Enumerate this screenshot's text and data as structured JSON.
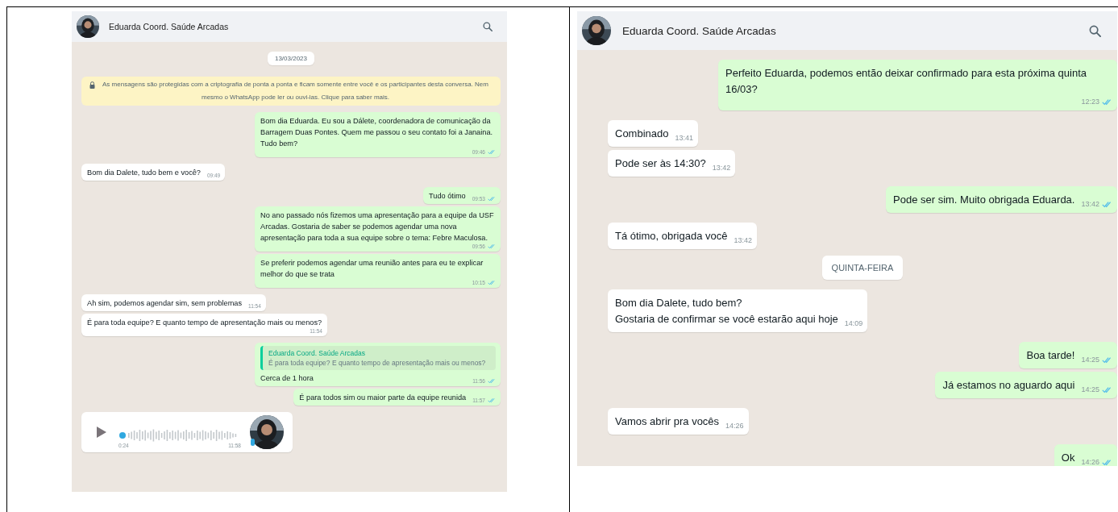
{
  "panels": [
    {
      "contact": "Eduarda Coord. Saúde Arcadas",
      "messages": [
        {
          "kind": "date",
          "text": "13/03/2023"
        },
        {
          "kind": "notice",
          "text": "As mensagens são protegidas com a criptografia de ponta a ponta e ficam somente entre você e os participantes desta conversa. Nem mesmo o WhatsApp pode ler ou ouvi-las. Clique para saber mais."
        },
        {
          "kind": "text",
          "sent": true,
          "text": "Bom dia Eduarda. Eu sou a Dálete, coordenadora de comunicação da Barragem Duas Pontes. Quem me passou o seu contato foi a Janaina. Tudo bem?",
          "time": "09:46",
          "read": true
        },
        {
          "kind": "text",
          "sent": false,
          "text": "Bom dia Dalete, tudo bem e você?",
          "time": "09:49"
        },
        {
          "kind": "text",
          "sent": true,
          "text": "Tudo ótimo",
          "time": "09:53",
          "read": true
        },
        {
          "kind": "text",
          "sent": true,
          "text": "No ano passado nós fizemos uma apresentação para a equipe da USF Arcadas. Gostaria de saber se podemos agendar uma nova apresentação para toda a sua equipe sobre o tema: Febre Maculosa.",
          "time": "09:56",
          "read": true
        },
        {
          "kind": "text",
          "sent": true,
          "text": "Se preferir podemos agendar uma reunião antes para eu te explicar melhor do que se trata",
          "time": "10:15",
          "read": true
        },
        {
          "kind": "text",
          "sent": false,
          "text": "Ah sim, podemos agendar sim, sem problemas",
          "time": "11:54"
        },
        {
          "kind": "text",
          "sent": false,
          "text": "É para toda equipe? E quanto tempo de apresentação mais ou menos?",
          "time": "11:54"
        },
        {
          "kind": "reply",
          "sent": true,
          "quote_author": "Eduarda Coord. Saúde Arcadas",
          "quote_text": "É para toda equipe? E quanto tempo de apresentação mais ou menos?",
          "text": "Cerca de 1 hora",
          "time": "11:56",
          "read": true
        },
        {
          "kind": "text",
          "sent": true,
          "text": "É para todos sim ou maior parte da equipe reunida",
          "time": "11:57",
          "read": true
        },
        {
          "kind": "audio",
          "sent": false,
          "duration": "0:24",
          "time": "11:58"
        }
      ]
    },
    {
      "contact": "Eduarda Coord. Saúde Arcadas",
      "messages": [
        {
          "kind": "text",
          "sent": true,
          "text": "Perfeito Eduarda, podemos então deixar confirmado para esta próxima quinta 16/03?",
          "time": "12:23",
          "read": true
        },
        {
          "kind": "text",
          "sent": false,
          "text": "Combinado",
          "time": "13:41"
        },
        {
          "kind": "text",
          "sent": false,
          "text": "Pode ser às 14:30?",
          "time": "13:42"
        },
        {
          "kind": "text",
          "sent": true,
          "text": "Pode ser sim. Muito obrigada Eduarda.",
          "time": "13:42",
          "read": true
        },
        {
          "kind": "text",
          "sent": false,
          "text": "Tá ótimo, obrigada você",
          "time": "13:42"
        },
        {
          "kind": "date",
          "text": "QUINTA-FEIRA"
        },
        {
          "kind": "text",
          "sent": false,
          "text": "Bom dia Dalete, tudo bem?\nGostaria de confirmar se você estarão aqui hoje",
          "time": "14:09"
        },
        {
          "kind": "text",
          "sent": true,
          "text": "Boa tarde!",
          "time": "14:25",
          "read": true
        },
        {
          "kind": "text",
          "sent": true,
          "text": "Já estamos no aguardo aqui",
          "time": "14:25",
          "read": true
        },
        {
          "kind": "text",
          "sent": false,
          "text": "Vamos abrir pra vocês",
          "time": "14:26"
        },
        {
          "kind": "text",
          "sent": true,
          "text": "Ok",
          "time": "14:26",
          "read": true
        }
      ]
    }
  ]
}
